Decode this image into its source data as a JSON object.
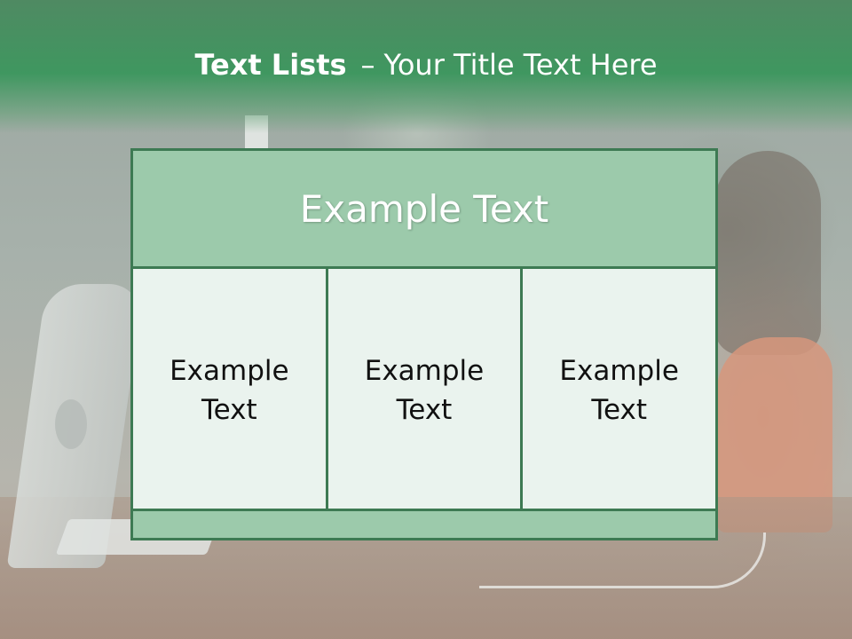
{
  "title": {
    "strong": "Text Lists",
    "dash": "–",
    "rest": "Your Title Text Here"
  },
  "table": {
    "header": "Example Text",
    "cells": [
      "Example Text",
      "Example Text",
      "Example Text"
    ]
  },
  "colors": {
    "header_band": "#3f9760",
    "table_border": "#3d7a53",
    "table_header_fill": "#9ccaab",
    "table_body_fill": "#eaf3ee"
  }
}
